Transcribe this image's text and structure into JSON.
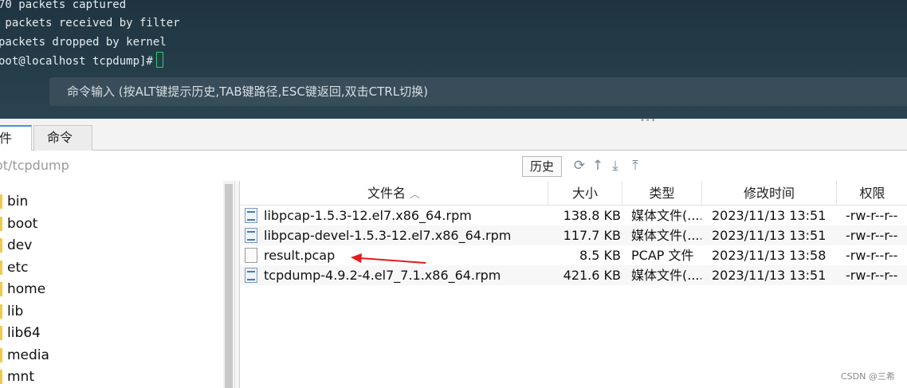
{
  "terminal": {
    "lines": [
      "70 packets captured",
      " packets received by filter",
      "packets dropped by kernel",
      "oot@localhost tcpdump]#"
    ],
    "command_placeholder": "命令输入 (按ALT键提示历史,TAB键路径,ESC键返回,双击CTRL切换)"
  },
  "tabs": [
    {
      "label": "件",
      "active": true
    },
    {
      "label": "命令",
      "active": false
    }
  ],
  "pathbar": {
    "path": "ot/tcpdump",
    "history_label": "历史"
  },
  "tree": {
    "items": [
      "bin",
      "boot",
      "dev",
      "etc",
      "home",
      "lib",
      "lib64",
      "media",
      "mnt"
    ]
  },
  "filelist": {
    "columns": {
      "name": "文件名",
      "size": "大小",
      "type": "类型",
      "modified": "修改时间",
      "permissions": "权限"
    },
    "rows": [
      {
        "name": "libpcap-1.5.3-12.el7.x86_64.rpm",
        "size": "138.8 KB",
        "type": "媒体文件(....",
        "modified": "2023/11/13 13:51",
        "permissions": "-rw-r--r--",
        "icon": "rpm-file-icon"
      },
      {
        "name": "libpcap-devel-1.5.3-12.el7.x86_64.rpm",
        "size": "117.7 KB",
        "type": "媒体文件(....",
        "modified": "2023/11/13 13:51",
        "permissions": "-rw-r--r--",
        "icon": "rpm-file-icon"
      },
      {
        "name": "result.pcap",
        "size": "8.5 KB",
        "type": "PCAP 文件",
        "modified": "2023/11/13 13:58",
        "permissions": "-rw-r--r--",
        "icon": "blank-file-icon"
      },
      {
        "name": "tcpdump-4.9.2-4.el7_7.1.x86_64.rpm",
        "size": "421.6 KB",
        "type": "媒体文件(....",
        "modified": "2023/11/13 13:51",
        "permissions": "-rw-r--r--",
        "icon": "rpm-file-icon"
      }
    ]
  },
  "colors": {
    "annotation_arrow": "#e8191a",
    "cursor": "#2ecc71"
  },
  "watermark": "CSDN @三希"
}
